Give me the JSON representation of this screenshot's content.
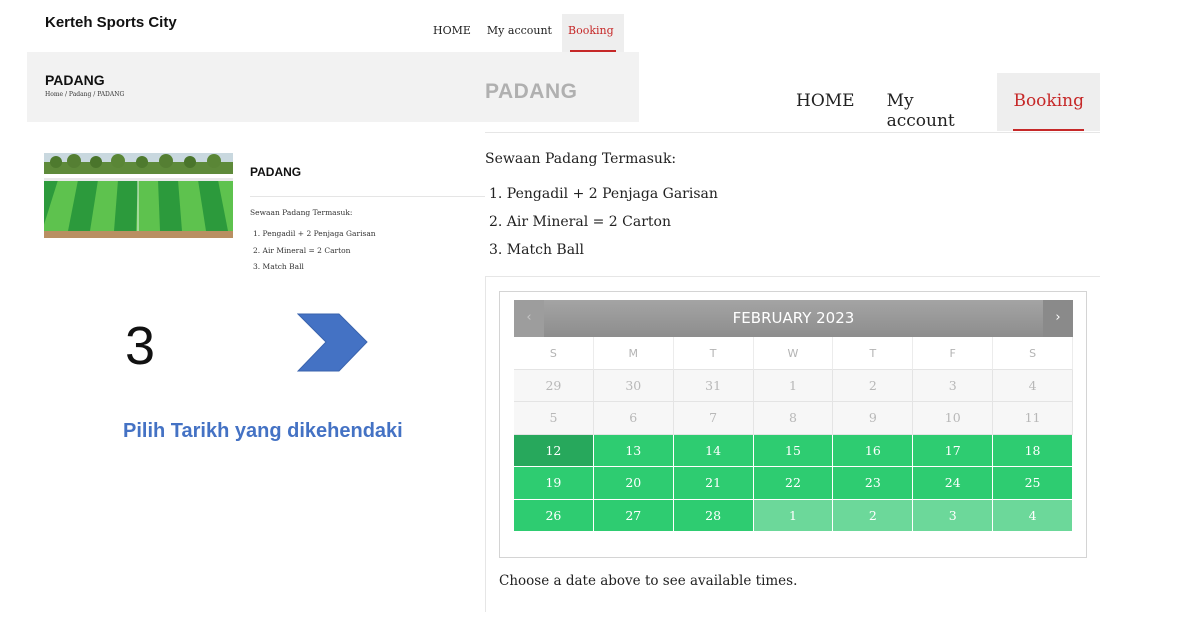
{
  "small_site": {
    "brand": "Kerteh Sports City",
    "nav": [
      "HOME",
      "My account",
      "Booking"
    ],
    "page_title": "PADANG",
    "breadcrumb": "Home / Padang / PADANG",
    "side_title": "PADANG",
    "intro": "Sewaan Padang Termasuk:",
    "items": [
      "1. Pengadil + 2 Penjaga Garisan",
      "2. Air Mineral = 2 Carton",
      "3. Match Ball"
    ]
  },
  "instruction": {
    "step": "3",
    "text": "Pilih Tarikh yang dikehendaki"
  },
  "big_page": {
    "title": "PADANG",
    "nav": [
      "HOME",
      "My account",
      "Booking"
    ],
    "active_nav": "Booking",
    "intro": "Sewaan Padang Termasuk:",
    "items": [
      "1. Pengadil + 2 Penjaga Garisan",
      "2. Air Mineral = 2 Carton",
      "3. Match Ball"
    ],
    "hint": "Choose a date above to see available times."
  },
  "calendar": {
    "prev_icon": "‹",
    "next_icon": "›",
    "month_label": "FEBRUARY 2023",
    "weekdays": [
      "S",
      "M",
      "T",
      "W",
      "T",
      "F",
      "S"
    ],
    "days": [
      {
        "n": "29",
        "state": "past"
      },
      {
        "n": "30",
        "state": "past"
      },
      {
        "n": "31",
        "state": "past"
      },
      {
        "n": "1",
        "state": "past"
      },
      {
        "n": "2",
        "state": "past"
      },
      {
        "n": "3",
        "state": "past"
      },
      {
        "n": "4",
        "state": "past"
      },
      {
        "n": "5",
        "state": "past"
      },
      {
        "n": "6",
        "state": "past"
      },
      {
        "n": "7",
        "state": "past"
      },
      {
        "n": "8",
        "state": "past"
      },
      {
        "n": "9",
        "state": "past"
      },
      {
        "n": "10",
        "state": "past"
      },
      {
        "n": "11",
        "state": "past"
      },
      {
        "n": "12",
        "state": "today"
      },
      {
        "n": "13",
        "state": "avail"
      },
      {
        "n": "14",
        "state": "avail"
      },
      {
        "n": "15",
        "state": "avail"
      },
      {
        "n": "16",
        "state": "avail"
      },
      {
        "n": "17",
        "state": "avail"
      },
      {
        "n": "18",
        "state": "avail"
      },
      {
        "n": "19",
        "state": "avail"
      },
      {
        "n": "20",
        "state": "avail"
      },
      {
        "n": "21",
        "state": "avail"
      },
      {
        "n": "22",
        "state": "avail"
      },
      {
        "n": "23",
        "state": "avail"
      },
      {
        "n": "24",
        "state": "avail"
      },
      {
        "n": "25",
        "state": "avail"
      },
      {
        "n": "26",
        "state": "avail"
      },
      {
        "n": "27",
        "state": "avail"
      },
      {
        "n": "28",
        "state": "avail"
      },
      {
        "n": "1",
        "state": "next"
      },
      {
        "n": "2",
        "state": "next"
      },
      {
        "n": "3",
        "state": "next"
      },
      {
        "n": "4",
        "state": "next"
      }
    ]
  },
  "colors": {
    "accent_red": "#c62828",
    "instruction_blue": "#4472c4",
    "available_green": "#2ecc71",
    "today_green": "#27a85c",
    "next_month_green": "#6cd89a",
    "calendar_header_gray": "#999999"
  }
}
